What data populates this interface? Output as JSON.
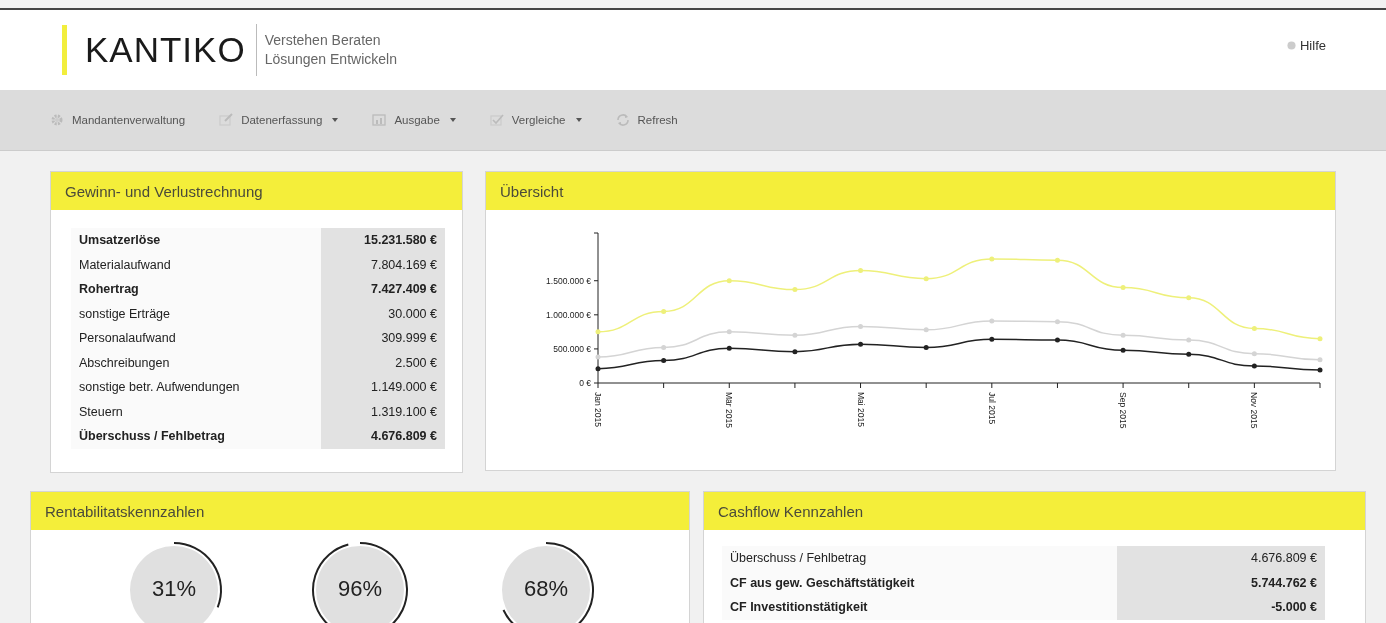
{
  "header": {
    "logo": "KANTIKO",
    "tagline": [
      "Verstehen Beraten",
      "Lösungen Entwickeln"
    ],
    "help": "Hilfe"
  },
  "nav": [
    {
      "label": "Mandantenverwaltung",
      "dropdown": false
    },
    {
      "label": "Datenerfassung",
      "dropdown": true
    },
    {
      "label": "Ausgabe",
      "dropdown": true
    },
    {
      "label": "Vergleiche",
      "dropdown": true
    },
    {
      "label": "Refresh",
      "dropdown": false
    }
  ],
  "income_statement": {
    "title": "Gewinn- und Verlustrechnung",
    "rows": [
      {
        "label": "Umsatzerlöse",
        "value": "15.231.580 €",
        "kind": "total"
      },
      {
        "label": "Materialaufwand",
        "value": "7.804.169 €",
        "kind": "item"
      },
      {
        "label": "Rohertrag",
        "value": "7.427.409 €",
        "kind": "total"
      },
      {
        "label": "sonstige Erträge",
        "value": "30.000 €",
        "kind": "item"
      },
      {
        "label": "Personalaufwand",
        "value": "309.999 €",
        "kind": "item"
      },
      {
        "label": "Abschreibungen",
        "value": "2.500 €",
        "kind": "item"
      },
      {
        "label": "sonstige betr. Aufwendungen",
        "value": "1.149.000 €",
        "kind": "item"
      },
      {
        "label": "Steuern",
        "value": "1.319.100 €",
        "kind": "item"
      },
      {
        "label": "Überschuss / Fehlbetrag",
        "value": "4.676.809 €",
        "kind": "total"
      }
    ]
  },
  "overview": {
    "title": "Übersicht",
    "chart_data": {
      "type": "line",
      "categories": [
        "Jan 2015",
        null,
        "Mär 2015",
        null,
        "Mai 2015",
        null,
        "Jul 2015",
        null,
        "Sep 2015",
        null,
        "Nov 2015",
        null
      ],
      "series": [
        {
          "color": "#eef07a",
          "values": [
            750000,
            1050000,
            1500000,
            1370000,
            1650000,
            1530000,
            1820000,
            1800000,
            1400000,
            1250000,
            800000,
            650000
          ]
        },
        {
          "color": "#d4d4d4",
          "values": [
            380000,
            520000,
            750000,
            700000,
            830000,
            780000,
            910000,
            900000,
            700000,
            630000,
            430000,
            340000
          ]
        },
        {
          "color": "#222222",
          "values": [
            210000,
            330000,
            510000,
            460000,
            570000,
            520000,
            640000,
            630000,
            480000,
            420000,
            250000,
            190000
          ]
        }
      ],
      "ylim": [
        0,
        2200000
      ],
      "yticks": [
        {
          "value": 0,
          "label": "0 €"
        },
        {
          "value": 500000,
          "label": "500.000 €"
        },
        {
          "value": 1000000,
          "label": "1.000.000 €"
        },
        {
          "value": 1500000,
          "label": "1.500.000 €"
        }
      ]
    }
  },
  "profitability": {
    "title": "Rentabilitatskennzahlen",
    "gauges": [
      {
        "reading": "31%"
      },
      {
        "reading": "96%"
      },
      {
        "reading": "68%"
      }
    ]
  },
  "cashflow": {
    "title": "Cashflow Kennzahlen",
    "rows": [
      {
        "label": "Überschuss / Fehlbetrag",
        "value": "4.676.809 €",
        "kind": "item"
      },
      {
        "label": "CF aus gew. Geschäftstätigkeit",
        "value": "5.744.762 €",
        "kind": "total"
      },
      {
        "label": "CF Investitionstätigkeit",
        "value": "-5.000 €",
        "kind": "total"
      }
    ]
  }
}
